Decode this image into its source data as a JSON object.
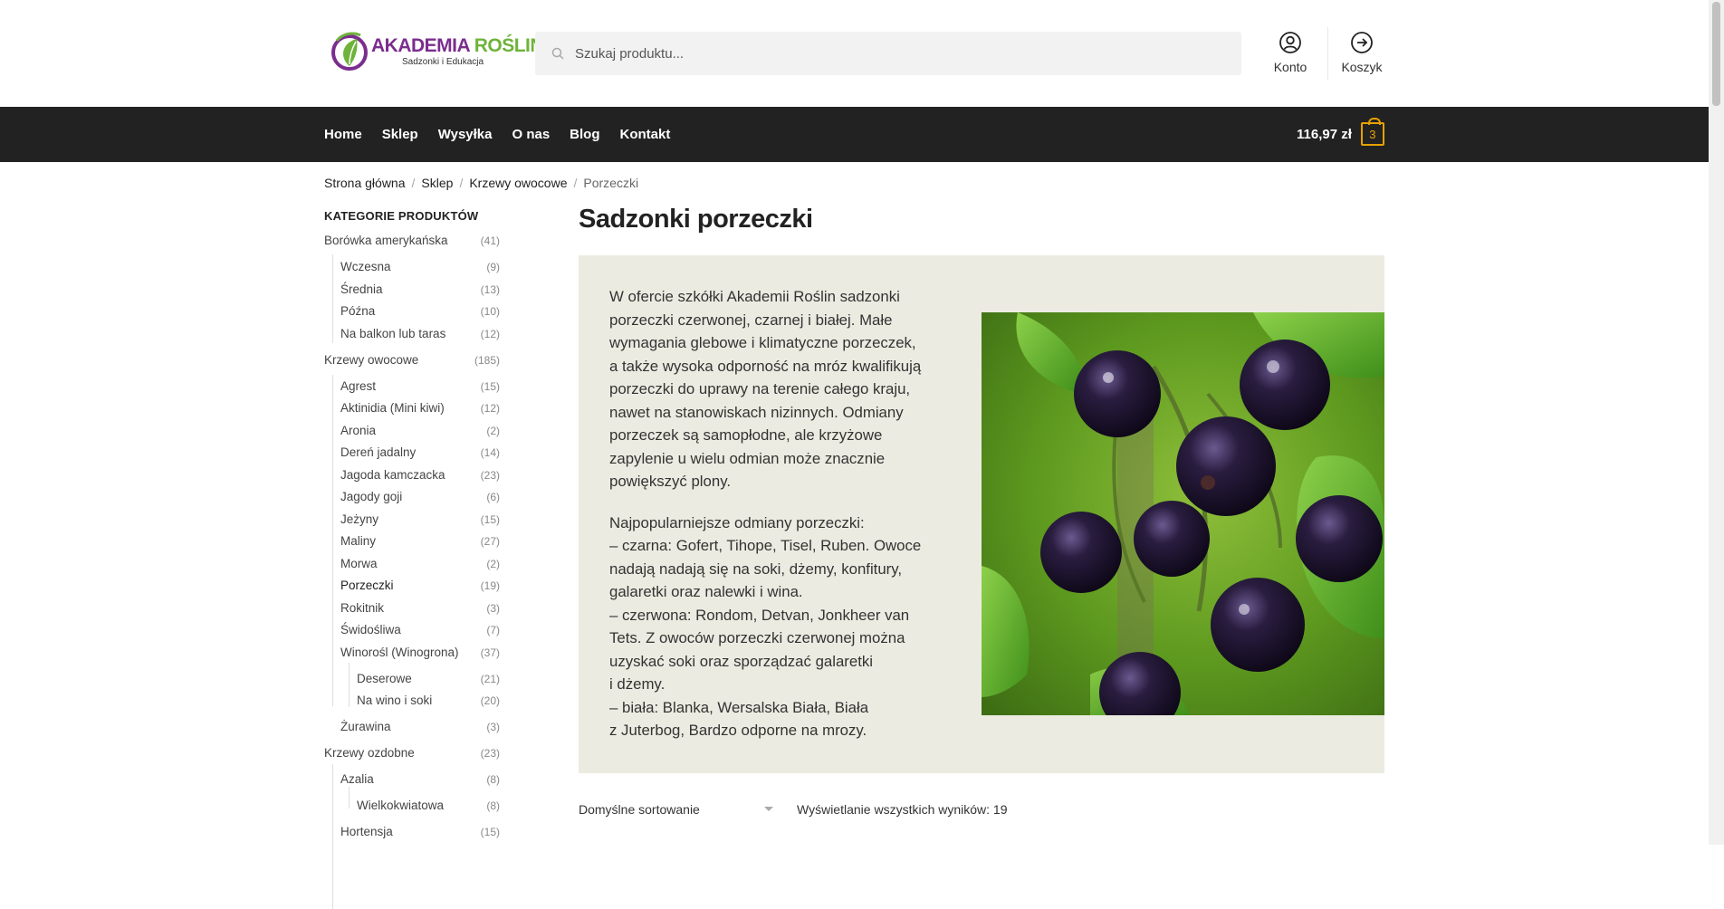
{
  "header": {
    "logo": {
      "title_part1": "AKADEMIA ",
      "title_part2": "ROŚLIN",
      "subtitle": "Sadzonki i Edukacja"
    },
    "search": {
      "placeholder": "Szukaj produktu..."
    },
    "account_label": "Konto",
    "cart_label": "Koszyk"
  },
  "nav": {
    "items": [
      "Home",
      "Sklep",
      "Wysyłka",
      "O nas",
      "Blog",
      "Kontakt"
    ],
    "cart_total": "116,97 zł",
    "cart_count": "3"
  },
  "breadcrumb": [
    "Strona główna",
    "Sklep",
    "Krzewy owocowe",
    "Porzeczki"
  ],
  "sidebar": {
    "title": "KATEGORIE PRODUKTÓW",
    "categories": [
      {
        "name": "Borówka amerykańska",
        "count": "(41)"
      },
      {
        "name": "Wczesna",
        "count": "(9)"
      },
      {
        "name": "Średnia",
        "count": "(13)"
      },
      {
        "name": "Późna",
        "count": "(10)"
      },
      {
        "name": "Na balkon lub taras",
        "count": "(12)"
      },
      {
        "name": "Krzewy owocowe",
        "count": "(185)"
      },
      {
        "name": "Agrest",
        "count": "(15)"
      },
      {
        "name": "Aktinidia (Mini kiwi)",
        "count": "(12)"
      },
      {
        "name": "Aronia",
        "count": "(2)"
      },
      {
        "name": "Dereń jadalny",
        "count": "(14)"
      },
      {
        "name": "Jagoda kamczacka",
        "count": "(23)"
      },
      {
        "name": "Jagody goji",
        "count": "(6)"
      },
      {
        "name": "Jeżyny",
        "count": "(15)"
      },
      {
        "name": "Maliny",
        "count": "(27)"
      },
      {
        "name": "Morwa",
        "count": "(2)"
      },
      {
        "name": "Porzeczki",
        "count": "(19)"
      },
      {
        "name": "Rokitnik",
        "count": "(3)"
      },
      {
        "name": "Świdośliwa",
        "count": "(7)"
      },
      {
        "name": "Winorośl (Winogrona)",
        "count": "(37)"
      },
      {
        "name": "Deserowe",
        "count": "(21)"
      },
      {
        "name": "Na wino i soki",
        "count": "(20)"
      },
      {
        "name": "Żurawina",
        "count": "(3)"
      },
      {
        "name": "Krzewy ozdobne",
        "count": "(23)"
      },
      {
        "name": "Azalia",
        "count": "(8)"
      },
      {
        "name": "Wielkokwiatowa",
        "count": "(8)"
      },
      {
        "name": "Hortensja",
        "count": "(15)"
      }
    ]
  },
  "main": {
    "title": "Sadzonki porzeczki",
    "description_p1": [
      "W ofercie szkółki Akademii Roślin sadzonki",
      "porzeczki czerwonej, czarnej i białej. Małe",
      "wymagania glebowe i klimatyczne porzeczek,",
      "a także wysoka odporność na mróz kwalifikują",
      "porzeczki do uprawy na terenie całego kraju,",
      "nawet na stanowiskach nizinnych. Odmiany",
      "porzeczek są samopłodne, ale krzyżowe",
      "zapylenie u wielu odmian może znacznie",
      "powiększyć plony."
    ],
    "description_p2": [
      "Najpopularniejsze odmiany porzeczki:",
      "– czarna: Gofert, Tihope, Tisel, Ruben. Owoce",
      "nadają nadają się na soki, dżemy, konfitury,",
      "galaretki oraz nalewki i wina.",
      "– czerwona: Rondom, Detvan, Jonkheer van",
      "Tets. Z owoców porzeczki czerwonej można",
      "uzyskać soki oraz sporządzać galaretki",
      "i dżemy.",
      "– biała: Blanka, Wersalska Biała, Biała",
      "z Juterbog, Bardzo odporne na mrozy."
    ],
    "sort_label": "Domyślne sortowanie",
    "results_text": "Wyświetlanie wszystkich wyników: 19"
  },
  "colors": {
    "nav_bg": "#222222",
    "accent": "#e6a100",
    "desc_bg": "#ecebe1",
    "logo_purple": "#7b2d8e",
    "logo_green": "#6fb33b"
  }
}
